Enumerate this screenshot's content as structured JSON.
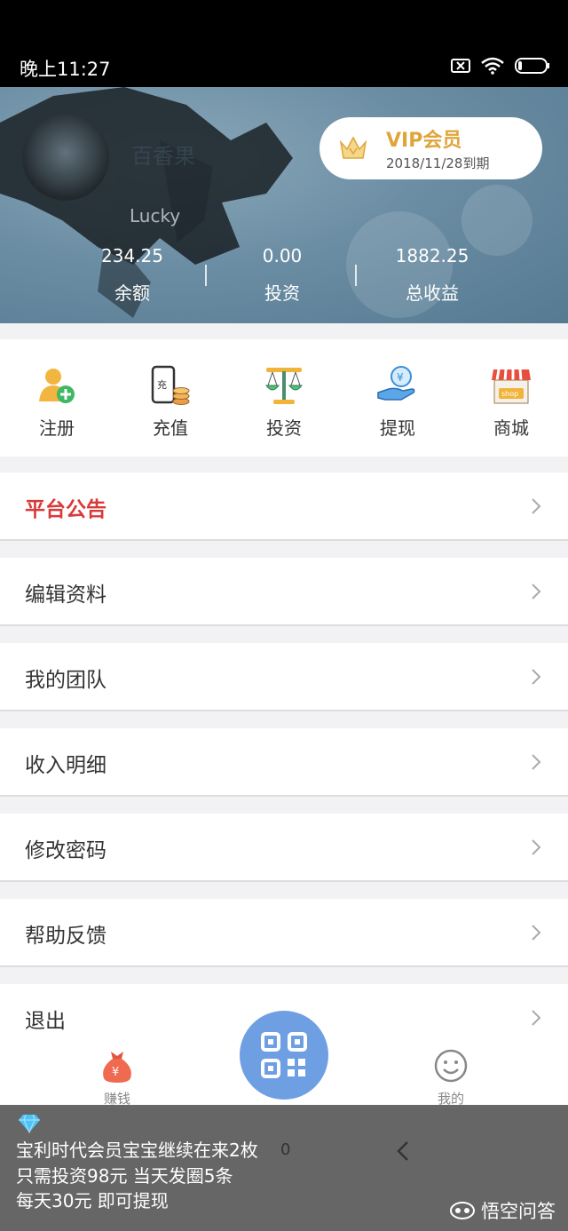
{
  "status_bar": {
    "time": "晚上11:27",
    "icons": [
      "sim-off-icon",
      "wifi-icon",
      "battery-icon"
    ]
  },
  "profile": {
    "name": "百香果",
    "sub": "Lucky",
    "vip": {
      "title": "VIP会员",
      "expire": "2018/11/28到期",
      "icon": "crown-icon"
    },
    "stats": [
      {
        "value": "234.25",
        "label": "余额"
      },
      {
        "value": "0.00",
        "label": "投资"
      },
      {
        "value": "1882.25",
        "label": "总收益"
      }
    ]
  },
  "quick_actions": [
    {
      "label": "注册",
      "icon": "register-user-icon"
    },
    {
      "label": "充值",
      "icon": "recharge-icon"
    },
    {
      "label": "投资",
      "icon": "scale-icon"
    },
    {
      "label": "提现",
      "icon": "withdraw-icon"
    },
    {
      "label": "商城",
      "icon": "shop-icon"
    }
  ],
  "menu": [
    {
      "label": "平台公告",
      "highlight": true
    },
    {
      "label": "编辑资料"
    },
    {
      "label": "我的团队"
    },
    {
      "label": "收入明细"
    },
    {
      "label": "修改密码"
    },
    {
      "label": "帮助反馈"
    },
    {
      "label": "退出"
    }
  ],
  "tabbar": [
    {
      "label": "赚钱",
      "icon": "money-bag-icon"
    },
    {
      "label": "",
      "icon": "qr-code-icon"
    },
    {
      "label": "我的",
      "icon": "smile-icon"
    }
  ],
  "overlay": {
    "lines": [
      "宝利时代会员宝宝继续在来2枚",
      "只需投资98元 当天发圈5条",
      "每天30元 即可提现"
    ],
    "fragment": "0",
    "watermark": "悟空问答"
  },
  "colors": {
    "vip_gold": "#e0a53a",
    "notice_red": "#d83a3a",
    "scan_blue": "#6f9fe3"
  }
}
